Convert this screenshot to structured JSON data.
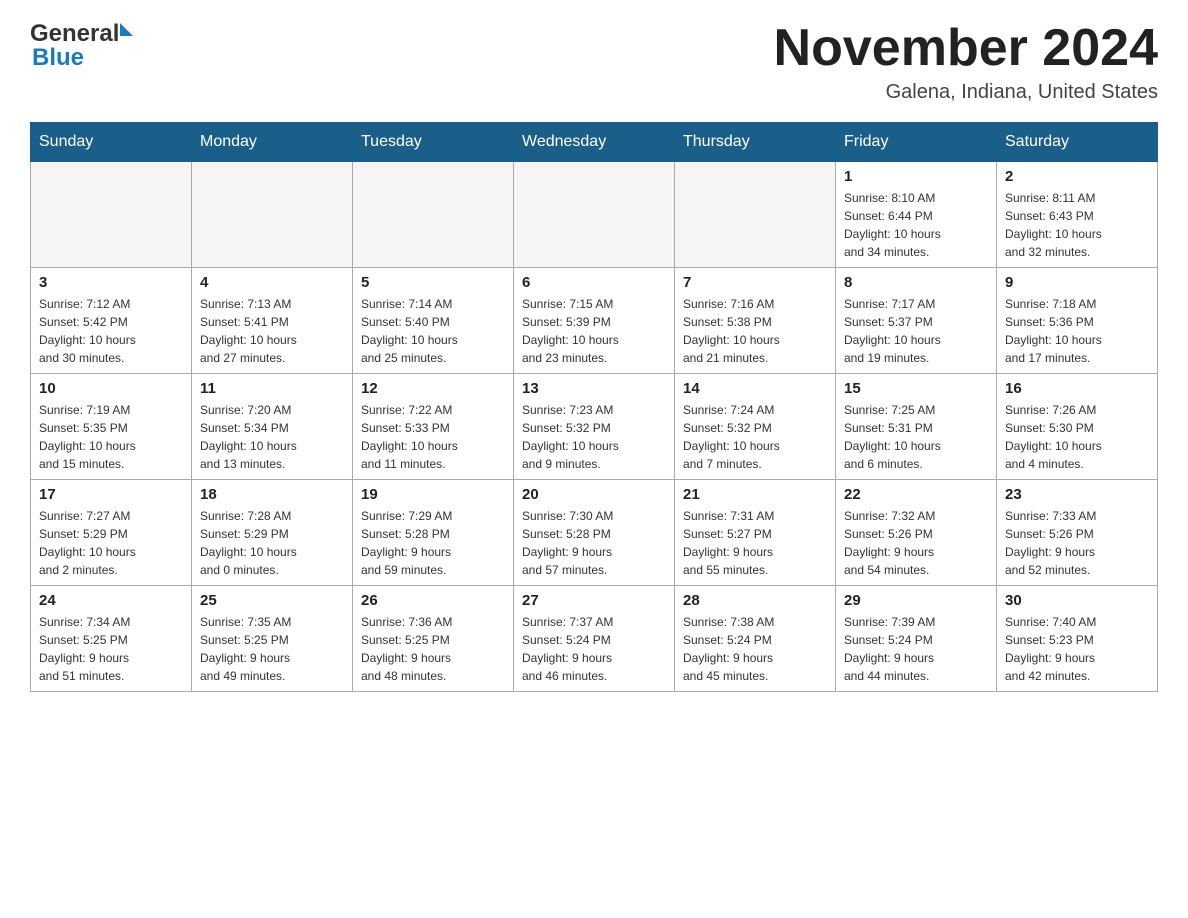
{
  "header": {
    "logo_line1": "General",
    "logo_line2": "Blue",
    "month_title": "November 2024",
    "location": "Galena, Indiana, United States"
  },
  "days_of_week": [
    "Sunday",
    "Monday",
    "Tuesday",
    "Wednesday",
    "Thursday",
    "Friday",
    "Saturday"
  ],
  "weeks": [
    [
      {
        "num": "",
        "info": ""
      },
      {
        "num": "",
        "info": ""
      },
      {
        "num": "",
        "info": ""
      },
      {
        "num": "",
        "info": ""
      },
      {
        "num": "",
        "info": ""
      },
      {
        "num": "1",
        "info": "Sunrise: 8:10 AM\nSunset: 6:44 PM\nDaylight: 10 hours\nand 34 minutes."
      },
      {
        "num": "2",
        "info": "Sunrise: 8:11 AM\nSunset: 6:43 PM\nDaylight: 10 hours\nand 32 minutes."
      }
    ],
    [
      {
        "num": "3",
        "info": "Sunrise: 7:12 AM\nSunset: 5:42 PM\nDaylight: 10 hours\nand 30 minutes."
      },
      {
        "num": "4",
        "info": "Sunrise: 7:13 AM\nSunset: 5:41 PM\nDaylight: 10 hours\nand 27 minutes."
      },
      {
        "num": "5",
        "info": "Sunrise: 7:14 AM\nSunset: 5:40 PM\nDaylight: 10 hours\nand 25 minutes."
      },
      {
        "num": "6",
        "info": "Sunrise: 7:15 AM\nSunset: 5:39 PM\nDaylight: 10 hours\nand 23 minutes."
      },
      {
        "num": "7",
        "info": "Sunrise: 7:16 AM\nSunset: 5:38 PM\nDaylight: 10 hours\nand 21 minutes."
      },
      {
        "num": "8",
        "info": "Sunrise: 7:17 AM\nSunset: 5:37 PM\nDaylight: 10 hours\nand 19 minutes."
      },
      {
        "num": "9",
        "info": "Sunrise: 7:18 AM\nSunset: 5:36 PM\nDaylight: 10 hours\nand 17 minutes."
      }
    ],
    [
      {
        "num": "10",
        "info": "Sunrise: 7:19 AM\nSunset: 5:35 PM\nDaylight: 10 hours\nand 15 minutes."
      },
      {
        "num": "11",
        "info": "Sunrise: 7:20 AM\nSunset: 5:34 PM\nDaylight: 10 hours\nand 13 minutes."
      },
      {
        "num": "12",
        "info": "Sunrise: 7:22 AM\nSunset: 5:33 PM\nDaylight: 10 hours\nand 11 minutes."
      },
      {
        "num": "13",
        "info": "Sunrise: 7:23 AM\nSunset: 5:32 PM\nDaylight: 10 hours\nand 9 minutes."
      },
      {
        "num": "14",
        "info": "Sunrise: 7:24 AM\nSunset: 5:32 PM\nDaylight: 10 hours\nand 7 minutes."
      },
      {
        "num": "15",
        "info": "Sunrise: 7:25 AM\nSunset: 5:31 PM\nDaylight: 10 hours\nand 6 minutes."
      },
      {
        "num": "16",
        "info": "Sunrise: 7:26 AM\nSunset: 5:30 PM\nDaylight: 10 hours\nand 4 minutes."
      }
    ],
    [
      {
        "num": "17",
        "info": "Sunrise: 7:27 AM\nSunset: 5:29 PM\nDaylight: 10 hours\nand 2 minutes."
      },
      {
        "num": "18",
        "info": "Sunrise: 7:28 AM\nSunset: 5:29 PM\nDaylight: 10 hours\nand 0 minutes."
      },
      {
        "num": "19",
        "info": "Sunrise: 7:29 AM\nSunset: 5:28 PM\nDaylight: 9 hours\nand 59 minutes."
      },
      {
        "num": "20",
        "info": "Sunrise: 7:30 AM\nSunset: 5:28 PM\nDaylight: 9 hours\nand 57 minutes."
      },
      {
        "num": "21",
        "info": "Sunrise: 7:31 AM\nSunset: 5:27 PM\nDaylight: 9 hours\nand 55 minutes."
      },
      {
        "num": "22",
        "info": "Sunrise: 7:32 AM\nSunset: 5:26 PM\nDaylight: 9 hours\nand 54 minutes."
      },
      {
        "num": "23",
        "info": "Sunrise: 7:33 AM\nSunset: 5:26 PM\nDaylight: 9 hours\nand 52 minutes."
      }
    ],
    [
      {
        "num": "24",
        "info": "Sunrise: 7:34 AM\nSunset: 5:25 PM\nDaylight: 9 hours\nand 51 minutes."
      },
      {
        "num": "25",
        "info": "Sunrise: 7:35 AM\nSunset: 5:25 PM\nDaylight: 9 hours\nand 49 minutes."
      },
      {
        "num": "26",
        "info": "Sunrise: 7:36 AM\nSunset: 5:25 PM\nDaylight: 9 hours\nand 48 minutes."
      },
      {
        "num": "27",
        "info": "Sunrise: 7:37 AM\nSunset: 5:24 PM\nDaylight: 9 hours\nand 46 minutes."
      },
      {
        "num": "28",
        "info": "Sunrise: 7:38 AM\nSunset: 5:24 PM\nDaylight: 9 hours\nand 45 minutes."
      },
      {
        "num": "29",
        "info": "Sunrise: 7:39 AM\nSunset: 5:24 PM\nDaylight: 9 hours\nand 44 minutes."
      },
      {
        "num": "30",
        "info": "Sunrise: 7:40 AM\nSunset: 5:23 PM\nDaylight: 9 hours\nand 42 minutes."
      }
    ]
  ]
}
